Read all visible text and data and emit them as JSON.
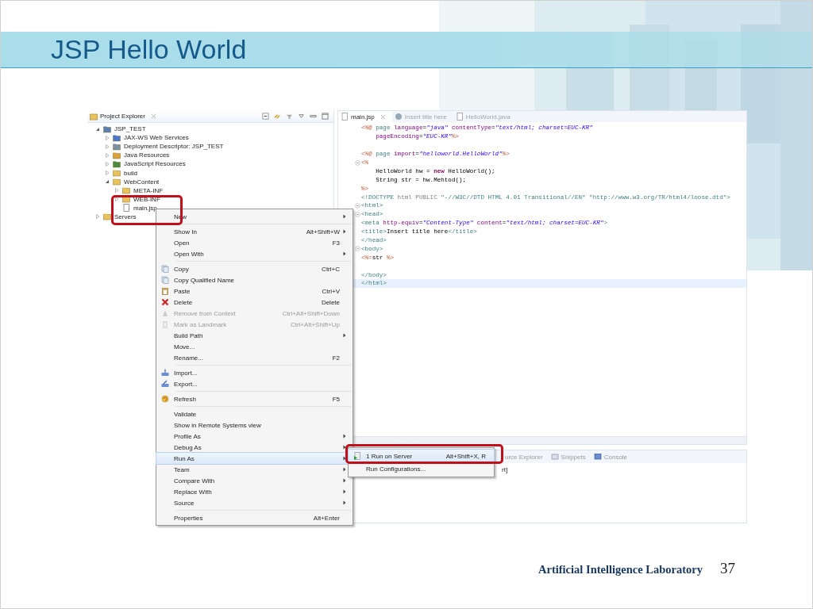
{
  "slide": {
    "title": "JSP Hello World",
    "footer": "Artificial Intelligence Laboratory",
    "page_number": "37"
  },
  "explorer": {
    "title": "Project Explorer",
    "tree": [
      {
        "label": "JSP_TEST",
        "kind": "project",
        "expanded": true,
        "children": [
          {
            "label": "JAX-WS Web Services",
            "kind": "services",
            "expanded": false
          },
          {
            "label": "Deployment Descriptor: JSP_TEST",
            "kind": "descriptor",
            "expanded": false
          },
          {
            "label": "Java Resources",
            "kind": "java",
            "expanded": false
          },
          {
            "label": "JavaScript Resources",
            "kind": "javascript",
            "expanded": false
          },
          {
            "label": "build",
            "kind": "folder",
            "expanded": false
          },
          {
            "label": "WebContent",
            "kind": "folder",
            "expanded": true,
            "children": [
              {
                "label": "META-INF",
                "kind": "folder",
                "expanded": false
              },
              {
                "label": "WEB-INF",
                "kind": "folder",
                "expanded": false
              },
              {
                "label": "main.jsp",
                "kind": "file"
              }
            ]
          }
        ]
      },
      {
        "label": "Servers",
        "kind": "servers",
        "expanded": false
      }
    ]
  },
  "editor": {
    "tabs": [
      {
        "label": "main.jsp",
        "kind": "jsp",
        "selected": true
      },
      {
        "label": "Insert title here",
        "kind": "web",
        "selected": false
      },
      {
        "label": "HelloWorld.java",
        "kind": "java",
        "selected": false
      }
    ],
    "lines": [
      {
        "fold": false,
        "current": false,
        "segments": [
          {
            "text": "<%@",
            "kind": "delim"
          },
          {
            "text": " page ",
            "kind": "tag"
          },
          {
            "text": "language",
            "kind": "attr"
          },
          {
            "text": "=",
            "kind": "plain"
          },
          {
            "text": "\"java\"",
            "kind": "string"
          },
          {
            "text": " contentType",
            "kind": "attr"
          },
          {
            "text": "=",
            "kind": "plain"
          },
          {
            "text": "\"text/html; charset=EUC-KR\"",
            "kind": "string"
          }
        ]
      },
      {
        "fold": false,
        "current": false,
        "segments": [
          {
            "text": "    pageEncoding",
            "kind": "attr"
          },
          {
            "text": "=",
            "kind": "plain"
          },
          {
            "text": "\"EUC-KR\"",
            "kind": "string"
          },
          {
            "text": "%>",
            "kind": "delim"
          }
        ]
      },
      {
        "fold": false,
        "current": false
      },
      {
        "fold": false,
        "current": false,
        "segments": [
          {
            "text": "<%@",
            "kind": "delim"
          },
          {
            "text": " page ",
            "kind": "tag"
          },
          {
            "text": "import",
            "kind": "attr"
          },
          {
            "text": "=",
            "kind": "plain"
          },
          {
            "text": "\"helloworld.HelloWorld\"",
            "kind": "string"
          },
          {
            "text": "%>",
            "kind": "delim"
          }
        ]
      },
      {
        "fold": true,
        "current": false,
        "segments": [
          {
            "text": "<%",
            "kind": "delim"
          }
        ]
      },
      {
        "fold": false,
        "current": false,
        "segments": [
          {
            "text": "    HelloWorld hw = ",
            "kind": "plain"
          },
          {
            "text": "new",
            "kind": "keyword"
          },
          {
            "text": " HelloWorld();",
            "kind": "plain"
          }
        ]
      },
      {
        "fold": false,
        "current": false,
        "segments": [
          {
            "text": "    String str = hw.Mehtod();",
            "kind": "plain"
          }
        ]
      },
      {
        "fold": false,
        "current": false,
        "segments": [
          {
            "text": "%>",
            "kind": "delim"
          }
        ]
      },
      {
        "fold": false,
        "current": false,
        "segments": [
          {
            "text": "<!DOCTYPE ",
            "kind": "tag"
          },
          {
            "text": "html",
            "kind": "doctype"
          },
          {
            "text": " PUBLIC ",
            "kind": "doctype"
          },
          {
            "text": "\"-//W3C//DTD HTML 4.01 Transitional//EN\" \"http://www.w3.org/TR/html4/loose.dtd\"",
            "kind": "pubid"
          },
          {
            "text": ">",
            "kind": "tag"
          }
        ]
      },
      {
        "fold": true,
        "current": false,
        "segments": [
          {
            "text": "<html>",
            "kind": "tag"
          }
        ]
      },
      {
        "fold": true,
        "current": false,
        "segments": [
          {
            "text": "<head>",
            "kind": "tag"
          }
        ]
      },
      {
        "fold": false,
        "current": false,
        "segments": [
          {
            "text": "<meta",
            "kind": "tag"
          },
          {
            "text": " http-equiv",
            "kind": "attr"
          },
          {
            "text": "=",
            "kind": "plain"
          },
          {
            "text": "\"Content-Type\"",
            "kind": "string"
          },
          {
            "text": " content",
            "kind": "attr"
          },
          {
            "text": "=",
            "kind": "plain"
          },
          {
            "text": "\"text/html; charset=EUC-KR\"",
            "kind": "string"
          },
          {
            "text": ">",
            "kind": "tag"
          }
        ]
      },
      {
        "fold": false,
        "current": false,
        "segments": [
          {
            "text": "<title>",
            "kind": "tag"
          },
          {
            "text": "Insert title here",
            "kind": "plain"
          },
          {
            "text": "</title>",
            "kind": "tag"
          }
        ]
      },
      {
        "fold": false,
        "current": false,
        "segments": [
          {
            "text": "</head>",
            "kind": "tag"
          }
        ]
      },
      {
        "fold": true,
        "current": false,
        "segments": [
          {
            "text": "<body>",
            "kind": "tag"
          }
        ]
      },
      {
        "fold": false,
        "current": false,
        "segments": [
          {
            "text": "<%=",
            "kind": "delim"
          },
          {
            "text": "str ",
            "kind": "plain"
          },
          {
            "text": "%>",
            "kind": "delim"
          }
        ]
      },
      {
        "fold": false,
        "current": false
      },
      {
        "fold": false,
        "current": false,
        "segments": [
          {
            "text": "</body>",
            "kind": "tag"
          }
        ]
      },
      {
        "fold": false,
        "current": true,
        "segments": [
          {
            "text": "</html>",
            "kind": "tag"
          }
        ]
      }
    ]
  },
  "bottom_panel": {
    "tabs": [
      {
        "label": "urce Explorer",
        "kind": "none"
      },
      {
        "label": "Snippets",
        "kind": "snippets"
      },
      {
        "label": "Console",
        "kind": "console"
      }
    ],
    "text": "rt]"
  },
  "context_menu": {
    "items": [
      {
        "kind": "item",
        "label": "New",
        "submenu": true,
        "disabled": false,
        "selected": false
      },
      {
        "kind": "separator"
      },
      {
        "kind": "item",
        "label": "Show In",
        "shortcut": "Alt+Shift+W",
        "submenu": true,
        "disabled": false,
        "selected": false
      },
      {
        "kind": "item",
        "label": "Open",
        "shortcut": "F3",
        "submenu": false,
        "disabled": false,
        "selected": false
      },
      {
        "kind": "item",
        "label": "Open With",
        "submenu": true,
        "disabled": false,
        "selected": false
      },
      {
        "kind": "separator"
      },
      {
        "kind": "copy",
        "label": "Copy",
        "shortcut": "Ctrl+C",
        "submenu": false,
        "disabled": false,
        "selected": false
      },
      {
        "kind": "copy",
        "label": "Copy Qualified Name",
        "submenu": false,
        "disabled": false,
        "selected": false
      },
      {
        "kind": "paste",
        "label": "Paste",
        "shortcut": "Ctrl+V",
        "submenu": false,
        "disabled": false,
        "selected": false
      },
      {
        "kind": "delete",
        "label": "Delete",
        "shortcut": "Delete",
        "submenu": false,
        "disabled": false,
        "selected": false
      },
      {
        "kind": "remove",
        "label": "Remove from Context",
        "shortcut": "Ctrl+Alt+Shift+Down",
        "submenu": false,
        "disabled": true,
        "selected": false
      },
      {
        "kind": "landmark",
        "label": "Mark as Landmark",
        "shortcut": "Ctrl+Alt+Shift+Up",
        "submenu": false,
        "disabled": true,
        "selected": false
      },
      {
        "kind": "item",
        "label": "Build Path",
        "submenu": true,
        "disabled": false,
        "selected": false
      },
      {
        "kind": "item",
        "label": "Move...",
        "submenu": false,
        "disabled": false,
        "selected": false
      },
      {
        "kind": "item",
        "label": "Rename...",
        "shortcut": "F2",
        "submenu": false,
        "disabled": false,
        "selected": false
      },
      {
        "kind": "separator"
      },
      {
        "kind": "import",
        "label": "Import...",
        "submenu": false,
        "disabled": false,
        "selected": false
      },
      {
        "kind": "export",
        "label": "Export...",
        "submenu": false,
        "disabled": false,
        "selected": false
      },
      {
        "kind": "separator"
      },
      {
        "kind": "refresh",
        "label": "Refresh",
        "shortcut": "F5",
        "submenu": false,
        "disabled": false,
        "selected": false
      },
      {
        "kind": "separator"
      },
      {
        "kind": "item",
        "label": "Validate",
        "submenu": false,
        "disabled": false,
        "selected": false
      },
      {
        "kind": "item",
        "label": "Show in Remote Systems view",
        "submenu": false,
        "disabled": false,
        "selected": false
      },
      {
        "kind": "item",
        "label": "Profile As",
        "submenu": true,
        "disabled": false,
        "selected": false
      },
      {
        "kind": "item",
        "label": "Debug As",
        "submenu": true,
        "disabled": false,
        "selected": false
      },
      {
        "kind": "item",
        "label": "Run As",
        "submenu": true,
        "disabled": false,
        "selected": true
      },
      {
        "kind": "item",
        "label": "Team",
        "submenu": true,
        "disabled": false,
        "selected": false
      },
      {
        "kind": "item",
        "label": "Compare With",
        "submenu": true,
        "disabled": false,
        "selected": false
      },
      {
        "kind": "item",
        "label": "Replace With",
        "submenu": true,
        "disabled": false,
        "selected": false
      },
      {
        "kind": "item",
        "label": "Source",
        "submenu": true,
        "disabled": false,
        "selected": false
      },
      {
        "kind": "separator"
      },
      {
        "kind": "item",
        "label": "Properties",
        "shortcut": "Alt+Enter",
        "submenu": false,
        "disabled": false,
        "selected": false
      }
    ]
  },
  "submenu": {
    "items": [
      {
        "kind": "server",
        "label": "1 Run on Server",
        "shortcut": "Alt+Shift+X, R",
        "selected": true
      },
      {
        "kind": "item",
        "label": "Run Configurations...",
        "selected": false
      }
    ]
  }
}
